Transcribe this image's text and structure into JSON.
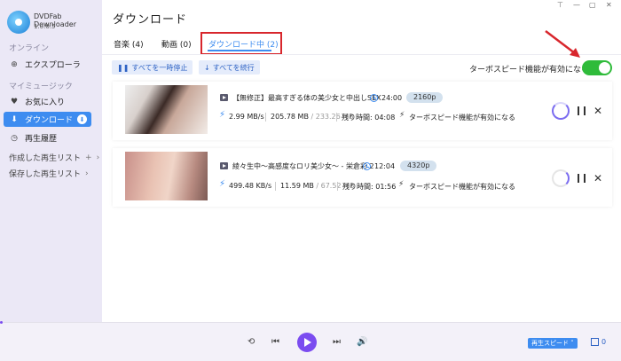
{
  "app": {
    "name": "DVDFab Downloader",
    "version": "1.0.0.5"
  },
  "sidebar": {
    "online_label": "オンライン",
    "explorer": "エクスプローラ",
    "my_music_label": "マイミュージック",
    "items": [
      {
        "label": "お気に入り",
        "icon": "heart-icon"
      },
      {
        "label": "ダウンロード",
        "icon": "download-icon"
      },
      {
        "label": "再生履歴",
        "icon": "clock-icon"
      }
    ],
    "created_playlists": "作成した再生リスト",
    "saved_playlists": "保存した再生リスト"
  },
  "header": {
    "title": "ダウンロード"
  },
  "tabs": [
    {
      "label": "音楽 (4)"
    },
    {
      "label": "動画 (0)"
    },
    {
      "label": "ダウンロード中 (2)",
      "active": true
    }
  ],
  "toolbar": {
    "pause_all": "すべてを一時停止",
    "resume_all": "すべてを続行",
    "turbo_label": "ターボスピード機能が有効になる",
    "turbo_enabled": true
  },
  "downloads": [
    {
      "title": "【無修正】最高すぎる体の美少女と中出しSEX",
      "duration": "24:00",
      "resolution": "2160p",
      "speed": "2.99 MB/s",
      "downloaded": "205.78 MB",
      "total": "/ 233.26 MB",
      "remaining_label": "残り時間",
      "remaining": "04:08",
      "turbo_note": "ターボスピード機能が有効になる"
    },
    {
      "title": "綾々生中～高感度なロリ美少女～ - 栄倉彩 2",
      "duration": "12:04",
      "resolution": "4320p",
      "speed": "499.48 KB/s",
      "downloaded": "11.59 MB",
      "total": "/ 67.52 MB",
      "remaining_label": "残り時間",
      "remaining": "01:56",
      "turbo_note": "ターボスピード機能が有効になる"
    }
  ],
  "player": {
    "speed_button": "再生スピード",
    "queue_count": "0"
  },
  "colors": {
    "accent": "#3d8cf0",
    "toggle_on": "#2fbb3a",
    "highlight_box": "#d8262c",
    "player_accent": "#7b4cf0"
  }
}
